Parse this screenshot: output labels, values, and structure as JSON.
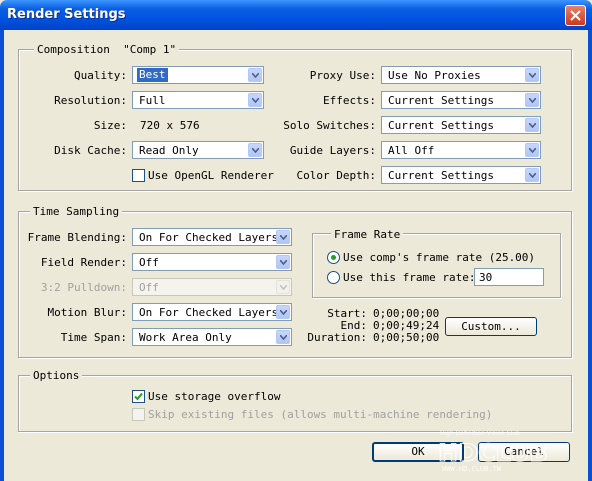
{
  "window": {
    "title": "Render Settings"
  },
  "composition": {
    "legend": "Composition  \"Comp 1\"",
    "quality": {
      "label": "Quality:",
      "value": "Best"
    },
    "resolution": {
      "label": "Resolution:",
      "value": "Full"
    },
    "size": {
      "label": "Size:",
      "value": "720 x 576"
    },
    "disk_cache": {
      "label": "Disk Cache:",
      "value": "Read Only"
    },
    "opengl": {
      "label": "Use OpenGL Renderer",
      "checked": false
    },
    "proxy_use": {
      "label": "Proxy Use:",
      "value": "Use No Proxies"
    },
    "effects": {
      "label": "Effects:",
      "value": "Current Settings"
    },
    "solo_switches": {
      "label": "Solo Switches:",
      "value": "Current Settings"
    },
    "guide_layers": {
      "label": "Guide Layers:",
      "value": "All Off"
    },
    "color_depth": {
      "label": "Color Depth:",
      "value": "Current Settings"
    }
  },
  "time_sampling": {
    "legend": "Time Sampling",
    "frame_blending": {
      "label": "Frame Blending:",
      "value": "On For Checked Layers"
    },
    "field_render": {
      "label": "Field Render:",
      "value": "Off"
    },
    "pulldown": {
      "label": "3:2 Pulldown:",
      "value": "Off"
    },
    "motion_blur": {
      "label": "Motion Blur:",
      "value": "On For Checked Layers"
    },
    "time_span": {
      "label": "Time Span:",
      "value": "Work Area Only"
    },
    "frame_rate": {
      "legend": "Frame Rate",
      "comp_rate": {
        "label": "Use comp's frame rate (25.00)",
        "selected": true
      },
      "this_rate": {
        "label": "Use this frame rate:",
        "value": "30",
        "selected": false
      }
    },
    "start": {
      "label": "Start:",
      "value": "0;00;00;00"
    },
    "end": {
      "label": "End:",
      "value": "0;00;49;24"
    },
    "duration": {
      "label": "Duration:",
      "value": "0;00;50;00"
    },
    "custom_button": "Custom..."
  },
  "options": {
    "legend": "Options",
    "storage_overflow": {
      "label": "Use storage overflow",
      "checked": true
    },
    "skip_existing": {
      "label": "Skip existing files (allows multi-machine rendering)",
      "checked": false
    }
  },
  "buttons": {
    "ok": "OK",
    "cancel": "Cancel"
  },
  "watermark": {
    "tagline": "High Definition Vision Club",
    "site": "WWW.HD.CLUB.TW",
    "logo_text": "HDCLUB"
  }
}
